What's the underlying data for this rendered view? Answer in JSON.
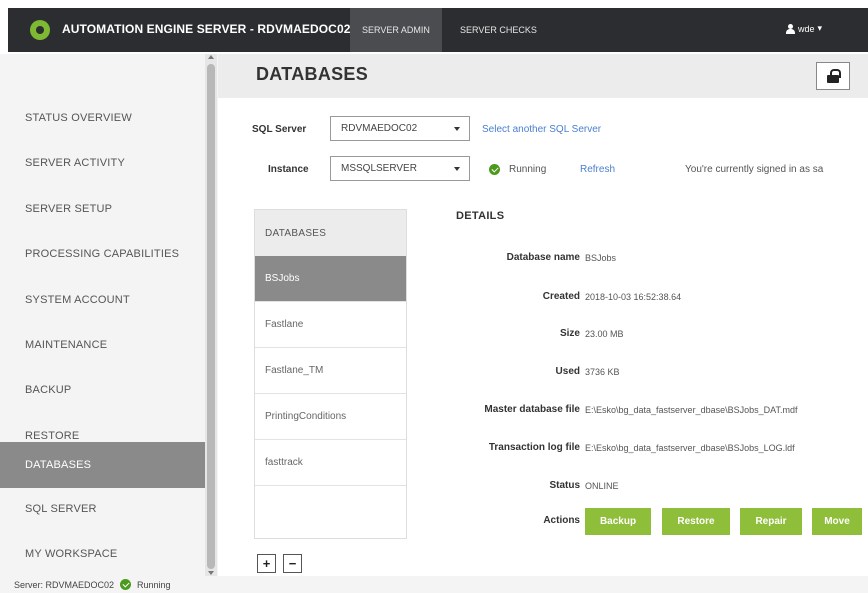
{
  "app": {
    "title": "AUTOMATION ENGINE SERVER - RDVMAEDOC02",
    "nav": [
      "SERVER ADMIN",
      "SERVER CHECKS"
    ],
    "user": "wde"
  },
  "sidebar": {
    "items": [
      {
        "label": "STATUS OVERVIEW"
      },
      {
        "label": "SERVER ACTIVITY"
      },
      {
        "label": "SERVER SETUP"
      },
      {
        "label": "PROCESSING CAPABILITIES"
      },
      {
        "label": "SYSTEM ACCOUNT"
      },
      {
        "label": "MAINTENANCE"
      },
      {
        "label": "BACKUP"
      },
      {
        "label": "RESTORE"
      },
      {
        "label": "DATABASES",
        "active": true
      },
      {
        "label": "SQL SERVER"
      },
      {
        "label": "MY WORKSPACE"
      }
    ]
  },
  "page": {
    "title": "DATABASES"
  },
  "sql": {
    "server_label": "SQL Server",
    "server_value": "RDVMAEDOC02",
    "select_another": "Select another SQL Server",
    "instance_label": "Instance",
    "instance_value": "MSSQLSERVER",
    "status": "Running",
    "refresh": "Refresh",
    "signed_in": "You're currently signed in as sa"
  },
  "db_list": {
    "header": "DATABASES",
    "items": [
      "BSJobs",
      "Fastlane",
      "Fastlane_TM",
      "PrintingConditions",
      "fasttrack"
    ],
    "selected": "BSJobs",
    "add_label": "+",
    "remove_label": "−"
  },
  "details": {
    "title": "DETAILS",
    "rows": [
      {
        "label": "Database name",
        "value": "BSJobs"
      },
      {
        "label": "Created",
        "value": "2018-10-03 16:52:38.64"
      },
      {
        "label": "Size",
        "value": "23.00 MB"
      },
      {
        "label": "Used",
        "value": "3736 KB"
      },
      {
        "label": "Master database file",
        "value": "E:\\Esko\\bg_data_fastserver_dbase\\BSJobs_DAT.mdf"
      },
      {
        "label": "Transaction log file",
        "value": "E:\\Esko\\bg_data_fastserver_dbase\\BSJobs_LOG.ldf"
      },
      {
        "label": "Status",
        "value": "ONLINE"
      }
    ],
    "actions_label": "Actions",
    "actions": [
      "Backup",
      "Restore",
      "Repair",
      "Move"
    ]
  },
  "statusbar": {
    "server": "Server: RDVMAEDOC02",
    "status": "Running"
  },
  "colors": {
    "topbar": "#2b2d30",
    "accent_green": "#8fbe3a",
    "link_blue": "#4b7fcf",
    "active_gray": "#8a8a8a",
    "running_green": "#4c9a1d"
  }
}
